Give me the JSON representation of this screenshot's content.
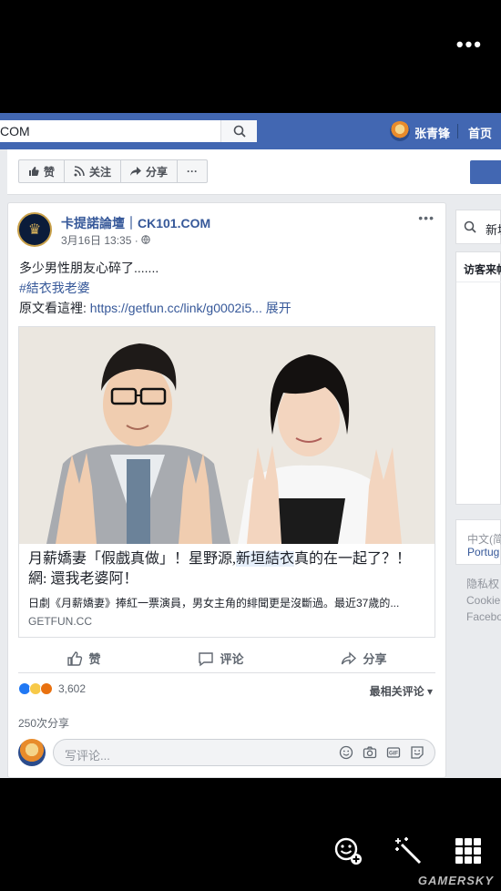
{
  "overlay": {
    "more_label": "•••",
    "watermark": "GAMERSKY"
  },
  "topbar": {
    "search_value": "COM",
    "user_name": "张青锋",
    "home_label": "首页"
  },
  "page_actions": {
    "like_label": "赞",
    "follow_label": "关注",
    "share_label": "分享",
    "more_label": "···"
  },
  "post": {
    "page_name": "卡提諾論壇｜CK101.COM",
    "time": "3月16日 13:35 · ",
    "text_line1": "多少男性朋友心碎了.......",
    "hashtag": "#結衣我老婆",
    "link_prefix": "原文看這裡: ",
    "link_url": "https://getfun.cc/link/g0002i5... ",
    "link_expand": "展开",
    "share": {
      "title_part1": "月薪嬌妻「假戲真做」！星野源,",
      "title_highlight": "新垣結衣",
      "title_part2": "真的在一起了？！ 網: 還我老婆阿！",
      "description": "日劇《月薪嬌妻》捧紅一票演員，男女主角的緋聞更是沒斷過。最近37歲的...",
      "domain": "GETFUN.CC"
    },
    "actions": {
      "like": "赞",
      "comment": "评论",
      "share": "分享"
    },
    "reaction_count": "3,602",
    "sort_label": "最相关评论 ▾",
    "share_count": "250次分享",
    "comment_placeholder": "写评论..."
  },
  "right_column": {
    "search_text": "新垣",
    "visitors_title": "访客来帖",
    "lang_current": "中文(简",
    "lang_other": "Portug",
    "footer_1": "隐私权",
    "footer_2": "Cookie",
    "footer_3": "Facebo"
  },
  "colors": {
    "brand_blue": "#4267b2",
    "link_blue": "#365899",
    "background": "#e9ebee"
  }
}
